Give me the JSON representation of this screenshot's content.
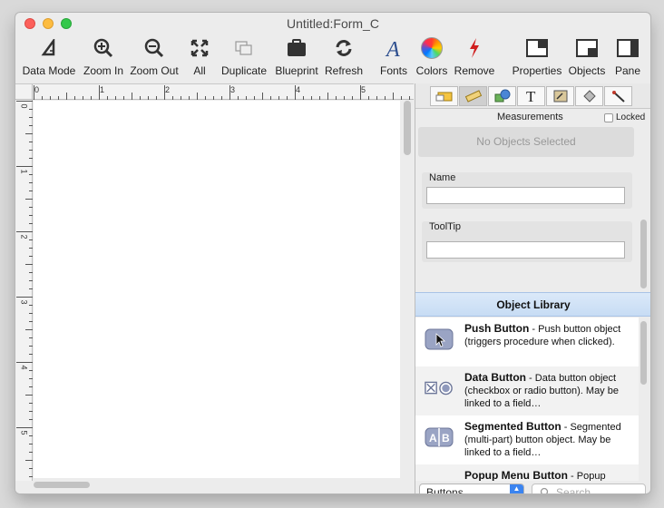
{
  "window": {
    "title": "Untitled:Form_C"
  },
  "toolbar": {
    "items": [
      {
        "label": "Data Mode",
        "icon": "data-mode-icon"
      },
      {
        "label": "Zoom In",
        "icon": "zoom-in-icon"
      },
      {
        "label": "Zoom Out",
        "icon": "zoom-out-icon"
      },
      {
        "label": "All",
        "icon": "zoom-all-icon"
      },
      {
        "label": "Duplicate",
        "icon": "duplicate-icon"
      },
      {
        "label": "Blueprint",
        "icon": "blueprint-icon"
      },
      {
        "label": "Refresh",
        "icon": "refresh-icon"
      },
      {
        "label": "Fonts",
        "icon": "fonts-icon"
      },
      {
        "label": "Colors",
        "icon": "colors-icon"
      },
      {
        "label": "Remove",
        "icon": "remove-icon"
      },
      {
        "label": "Properties",
        "icon": "properties-icon"
      },
      {
        "label": "Objects",
        "icon": "objects-icon"
      },
      {
        "label": "Pane",
        "icon": "pane-icon"
      }
    ]
  },
  "ruler": {
    "top_numbers": [
      "0",
      "1",
      "2",
      "3",
      "4",
      "5"
    ],
    "left_numbers": [
      "0",
      "1",
      "2",
      "3",
      "4",
      "5"
    ]
  },
  "inspector": {
    "section_title": "Measurements",
    "locked_label": "Locked",
    "no_objects": "No Objects Selected",
    "name_label": "Name",
    "name_value": "",
    "tooltip_label": "ToolTip",
    "tooltip_value": ""
  },
  "library": {
    "header": "Object Library",
    "items": [
      {
        "name": "Push Button",
        "desc": " - Push button object (triggers procedure when clicked)."
      },
      {
        "name": "Data Button",
        "desc": " - Data button object (checkbox or radio button). May be linked to a field…"
      },
      {
        "name": "Segmented Button",
        "desc": " - Segmented (multi-part) button object. May be linked to a field…"
      },
      {
        "name": "Popup Menu Button",
        "desc": " - Popup"
      }
    ],
    "filter_value": "Buttons",
    "search_placeholder": "Search"
  },
  "colors": {
    "accent": "#3b84f0",
    "library_header": "#c7dcf4",
    "remove_red": "#d01f1f"
  }
}
